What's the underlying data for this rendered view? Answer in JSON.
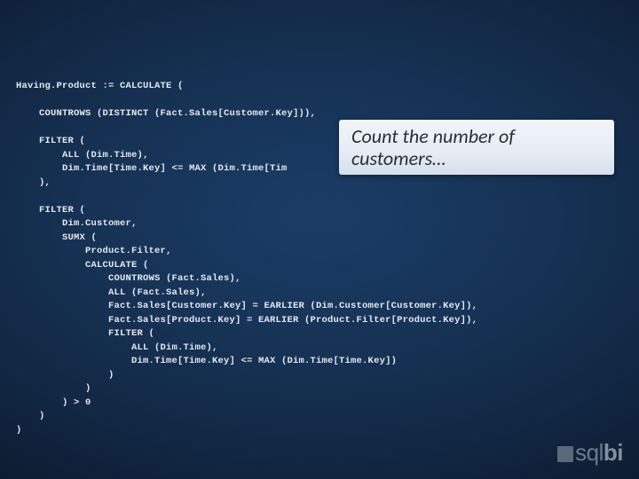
{
  "code": "Having.Product := CALCULATE (\n\n    COUNTROWS (DISTINCT (Fact.Sales[Customer.Key])),\n\n    FILTER (\n        ALL (Dim.Time),\n        Dim.Time[Time.Key] <= MAX (Dim.Time[Tim\n    ),\n\n    FILTER (\n        Dim.Customer,\n        SUMX (\n            Product.Filter,\n            CALCULATE (\n                COUNTROWS (Fact.Sales),\n                ALL (Fact.Sales),\n                Fact.Sales[Customer.Key] = EARLIER (Dim.Customer[Customer.Key]),\n                Fact.Sales[Product.Key] = EARLIER (Product.Filter[Product.Key]),\n                FILTER (\n                    ALL (Dim.Time),\n                    Dim.Time[Time.Key] <= MAX (Dim.Time[Time.Key])\n                )\n            )\n        ) > 0\n    )\n)",
  "callout": "Count the number of\ncustomers…",
  "logo": {
    "part1": "sql",
    "part2": "bi"
  }
}
